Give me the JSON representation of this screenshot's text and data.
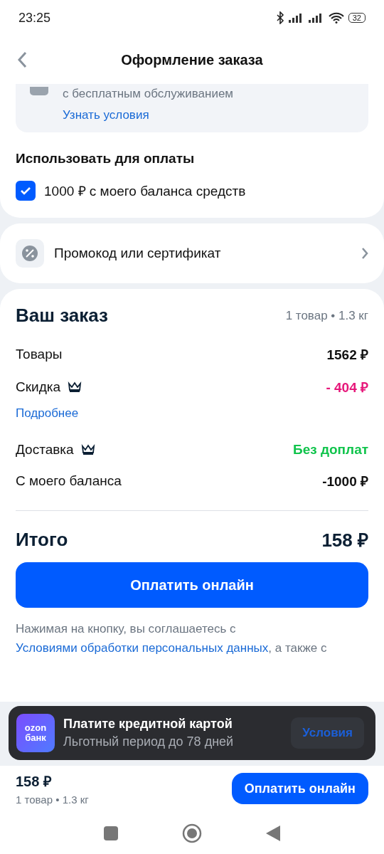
{
  "status_bar": {
    "time": "23:25",
    "battery": "32"
  },
  "header": {
    "title": "Оформление заказа"
  },
  "credit_offer": {
    "text": "с бесплатным обслуживанием",
    "link": "Узнать условия"
  },
  "payment": {
    "title": "Использовать для оплаты",
    "options": [
      {
        "label": "1000 ₽ с моего баланса средств",
        "checked": true
      }
    ]
  },
  "promo": {
    "label": "Промокод или сертификат"
  },
  "order": {
    "title": "Ваш заказ",
    "summary": "1 товар • 1.3 кг",
    "lines": [
      {
        "label": "Товары",
        "value": "1562 ₽",
        "kind": "plain",
        "crown": false
      },
      {
        "label": "Скидка",
        "value": "- 404 ₽",
        "kind": "discount",
        "crown": true,
        "link": "Подробнее"
      },
      {
        "label": "Доставка",
        "value": "Без доплат",
        "kind": "free",
        "crown": true
      },
      {
        "label": "С моего баланса",
        "value": "-1000 ₽",
        "kind": "plain",
        "crown": false
      }
    ],
    "total_label": "Итого",
    "total": "158 ₽",
    "pay_button": "Оплатить онлайн",
    "disclaimer": {
      "text": "Нажимая на кнопку, вы соглашаетесь с",
      "link": "Условиями обработки персональных данных",
      "tail": ", а также с"
    }
  },
  "banner": {
    "logo_top": "ozon",
    "logo_bottom": "банк",
    "title": "Платите кредитной картой",
    "subtitle": "Льготный период до 78 дней",
    "button": "Условия"
  },
  "bottom_bar": {
    "total": "158 ₽",
    "summary": "1 товар • 1.3 кг",
    "button": "Оплатить онлайн"
  }
}
